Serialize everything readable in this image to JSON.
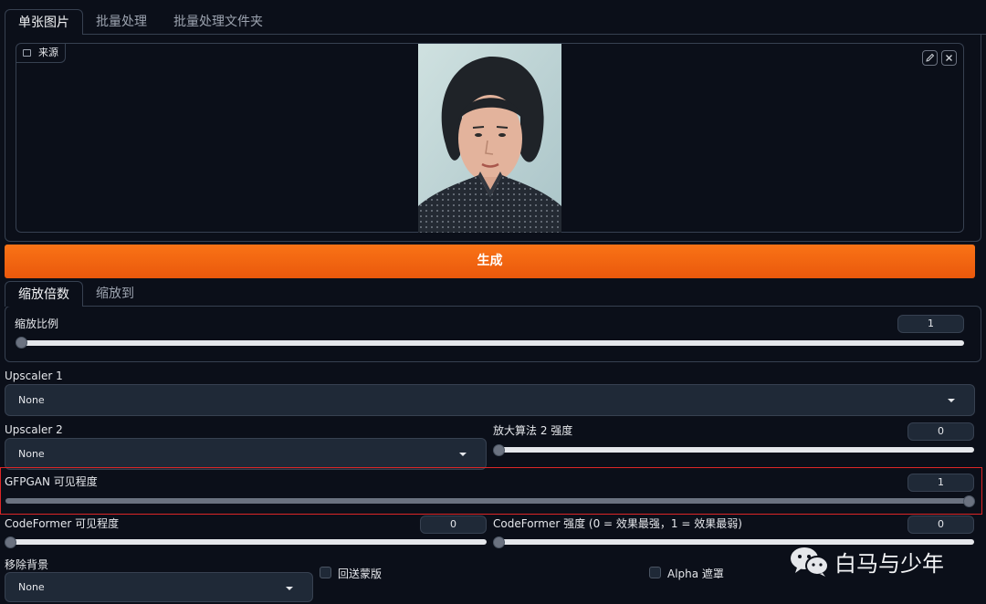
{
  "tabs": [
    "单张图片",
    "批量处理",
    "批量处理文件夹"
  ],
  "source": {
    "label": "来源"
  },
  "generate": {
    "label": "生成"
  },
  "scale_tabs": [
    "缩放倍数",
    "缩放到"
  ],
  "scale": {
    "label": "缩放比例",
    "value": "1",
    "level": 0
  },
  "upscaler1": {
    "label": "Upscaler 1",
    "value": "None"
  },
  "upscaler2": {
    "label": "Upscaler 2",
    "value": "None"
  },
  "upscaler2_strength": {
    "label": "放大算法 2 强度",
    "value": "0",
    "level": 0
  },
  "gfpgan": {
    "label": "GFPGAN 可见程度",
    "value": "1",
    "level": 1
  },
  "codeformer_visibility": {
    "label": "CodeFormer 可见程度",
    "value": "0",
    "level": 0
  },
  "codeformer_weight": {
    "label": "CodeFormer 强度 (0 = 效果最强，1 = 效果最弱)",
    "value": "0",
    "level": 0
  },
  "remove_bg": {
    "label": "移除背景",
    "value": "None"
  },
  "return_mask": {
    "label": "回送蒙版"
  },
  "alpha_mask": {
    "label": "Alpha 遮罩"
  },
  "watermark": {
    "text": "白马与少年"
  },
  "colors": {
    "accent": "#f97316",
    "highlight": "#dc2626"
  }
}
